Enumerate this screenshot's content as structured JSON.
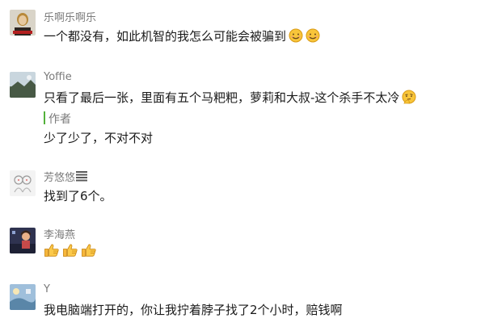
{
  "comments": [
    {
      "name": "乐啊乐啊乐",
      "text": "一个都没有，如此机智的我怎么可能会被骗到",
      "emojis": [
        "smile-icon",
        "smile-icon"
      ]
    },
    {
      "name": "Yoffie",
      "text": "只看了最后一张，里面有五个马粑粑，萝莉和大叔-这个杀手不太冷",
      "emojis": [
        "thinking-icon"
      ],
      "author_tag": "作者",
      "reply": "少了少了，不对不对"
    },
    {
      "name": "芳悠悠",
      "text": "找到了6个。"
    },
    {
      "name": "李海燕",
      "text": "",
      "emojis": [
        "thumbs-up-icon",
        "thumbs-up-icon",
        "thumbs-up-icon"
      ]
    },
    {
      "name": "Y",
      "text": "我电脑端打开的，你让我拧着脖子找了2个小时，赔钱啊"
    }
  ],
  "colors": {
    "name": "#7a7a7a",
    "text": "#1a1a1a",
    "author_bar": "#53b13a",
    "emoji_yellow": "#f8c53a",
    "emoji_edge": "#d99a14"
  }
}
